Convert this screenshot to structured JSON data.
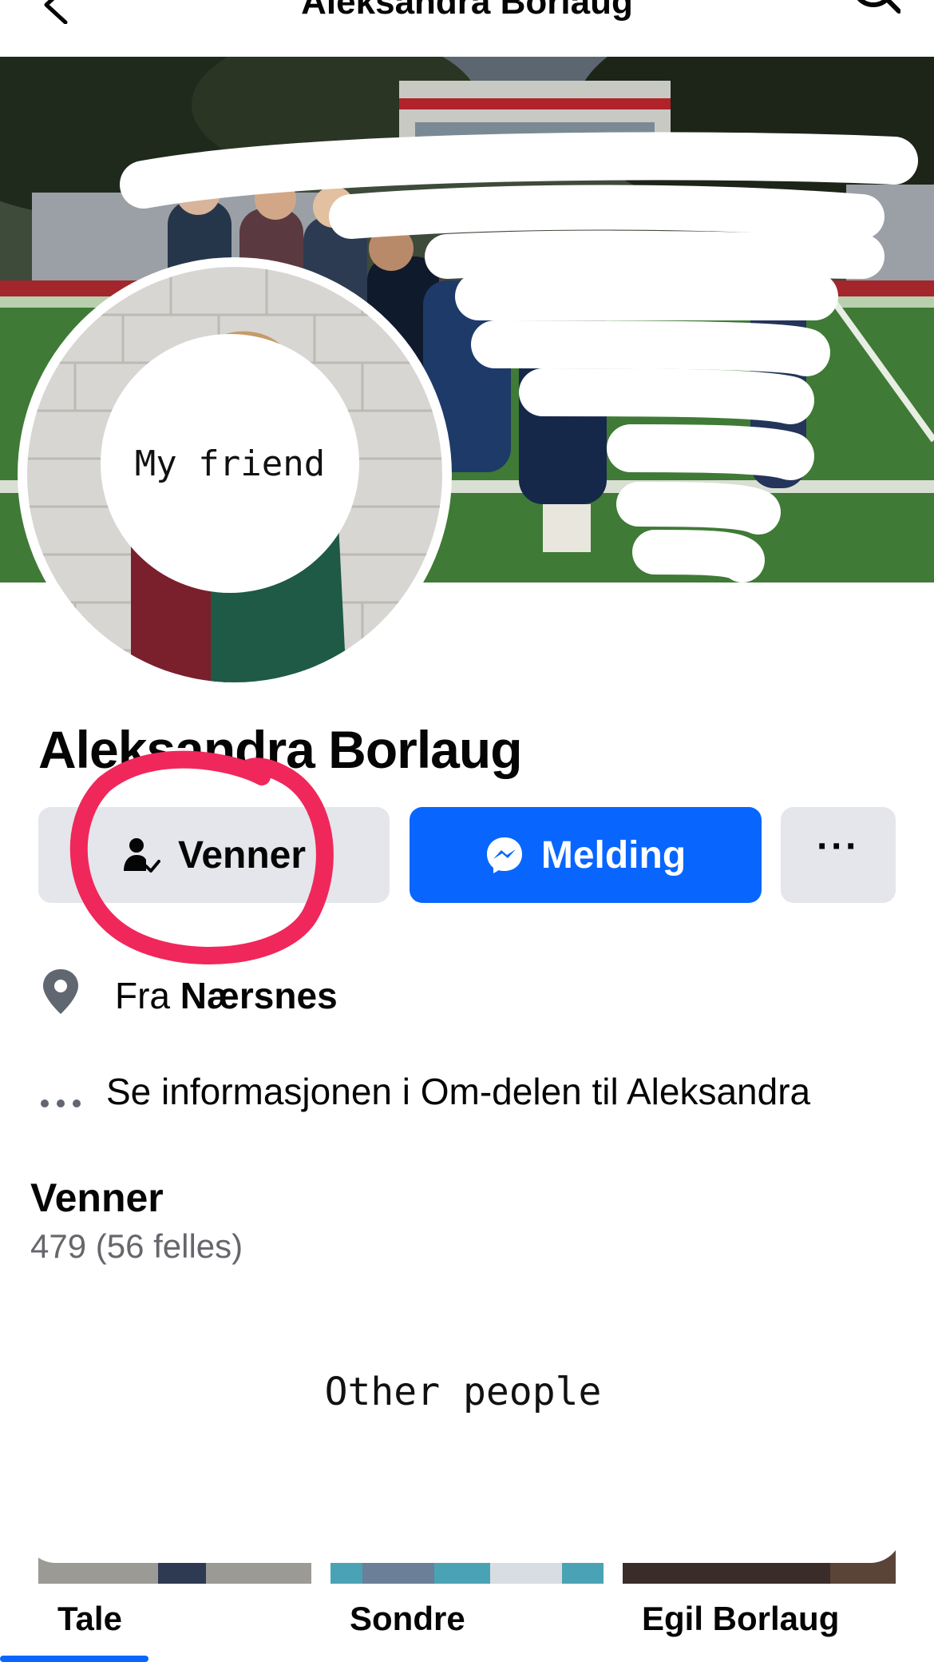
{
  "header": {
    "title": "Aleksandra Borlaug",
    "back_icon": "chevron-left-icon",
    "search_icon": "search-icon"
  },
  "profile": {
    "name": "Aleksandra Borlaug",
    "avatar_label": "My friend"
  },
  "actions": {
    "friends_label": "Venner",
    "message_label": "Melding",
    "more_label": "···"
  },
  "info": {
    "location_prefix": "Fra",
    "location_place": "Nærsnes",
    "about_text": "Se informasjonen i Om-delen til Aleksandra"
  },
  "friends": {
    "heading": "Venner",
    "count": "479 (56 felles)",
    "overlay_label": "Other people",
    "cards": [
      {
        "name": "Tale"
      },
      {
        "name": "Sondre"
      },
      {
        "name": "Egil Borlaug"
      }
    ]
  },
  "colors": {
    "accent": "#0866ff",
    "button_gray": "#e4e6eb",
    "annotation": "#f0275a",
    "secondary_text": "#65676b"
  }
}
